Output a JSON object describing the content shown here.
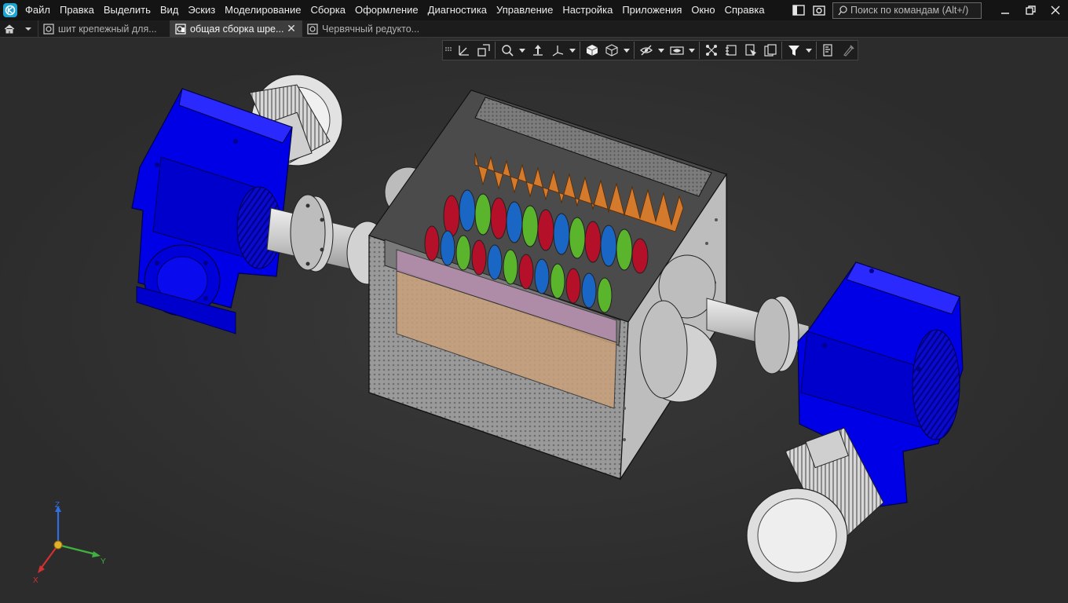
{
  "app": {
    "logo_icon": "kompas-3d-logo-icon",
    "accent": "#1fa3d1"
  },
  "menu": [
    {
      "id": "file",
      "label": "Файл"
    },
    {
      "id": "edit",
      "label": "Правка"
    },
    {
      "id": "select",
      "label": "Выделить"
    },
    {
      "id": "view",
      "label": "Вид"
    },
    {
      "id": "sketch",
      "label": "Эскиз"
    },
    {
      "id": "modeling",
      "label": "Моделирование"
    },
    {
      "id": "assembly",
      "label": "Сборка"
    },
    {
      "id": "design",
      "label": "Оформление"
    },
    {
      "id": "diagnostics",
      "label": "Диагностика"
    },
    {
      "id": "control",
      "label": "Управление"
    },
    {
      "id": "settings",
      "label": "Настройка"
    },
    {
      "id": "apps",
      "label": "Приложения"
    },
    {
      "id": "window",
      "label": "Окно"
    },
    {
      "id": "help",
      "label": "Справка"
    }
  ],
  "search": {
    "placeholder": "Поиск по командам (Alt+/)"
  },
  "tabs": [
    {
      "label": "шит крепежный для...",
      "active": false,
      "icon": "part-icon"
    },
    {
      "label": "общая сборка шре...",
      "active": true,
      "icon": "assembly-icon"
    },
    {
      "label": "Червячный редукто...",
      "active": false,
      "icon": "part-icon"
    }
  ],
  "view_toolbar": {
    "buttons": [
      "orientation-icon",
      "view-from-normal-icon",
      "zoom-icon",
      "pan-rotate-icon",
      "axis-orient-icon",
      "shaded-display-icon",
      "wireframe-display-icon",
      "hide-icon",
      "visibility-icon",
      "section-icon",
      "layer-icon",
      "sheet-icon",
      "copy-view-icon",
      "filter-icon",
      "measure-icon",
      "eyedropper-icon"
    ]
  },
  "colors": {
    "motor_body": "#0a0adf",
    "metal": "#c8c8c8",
    "blade_red": "#b4102a",
    "blade_green": "#5ab52d",
    "blade_blue": "#1a66c4",
    "blade_orange": "#d47a2c"
  },
  "axes": {
    "x": "X",
    "y": "Y",
    "z": "Z"
  }
}
